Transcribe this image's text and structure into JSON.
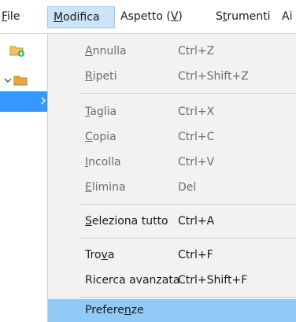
{
  "menubar": {
    "file": {
      "mnemonic": "F",
      "rest": "ile"
    },
    "modifica": {
      "mnemonic": "M",
      "rest": "odifica"
    },
    "aspetto": {
      "pre": "Aspetto (",
      "mnemonic": "V",
      "post": ")"
    },
    "strumenti": {
      "pre": "S",
      "mnemonic": "t",
      "post": "rumenti"
    },
    "truncated": "Ai"
  },
  "menu": {
    "items": [
      {
        "pre": "",
        "mnemonic": "A",
        "post": "nnulla",
        "shortcut": "Ctrl+Z",
        "enabled": false
      },
      {
        "pre": "",
        "mnemonic": "R",
        "post": "ipeti",
        "shortcut": "Ctrl+Shift+Z",
        "enabled": false
      },
      {
        "pre": "",
        "mnemonic": "T",
        "post": "aglia",
        "shortcut": "Ctrl+X",
        "enabled": false
      },
      {
        "pre": "",
        "mnemonic": "C",
        "post": "opia",
        "shortcut": "Ctrl+C",
        "enabled": false
      },
      {
        "pre": "",
        "mnemonic": "I",
        "post": "ncolla",
        "shortcut": "Ctrl+V",
        "enabled": false
      },
      {
        "pre": "",
        "mnemonic": "E",
        "post": "limina",
        "shortcut": "Del",
        "enabled": false
      },
      {
        "pre": "",
        "mnemonic": "S",
        "post": "eleziona tutto",
        "shortcut": "Ctrl+A",
        "enabled": true
      },
      {
        "pre": "Tro",
        "mnemonic": "v",
        "post": "a",
        "shortcut": "Ctrl+F",
        "enabled": true
      },
      {
        "pre": "Ricerca avanzata",
        "mnemonic": "",
        "post": "",
        "shortcut": "Ctrl+Shift+F",
        "enabled": true
      },
      {
        "pre": "Prefere",
        "mnemonic": "n",
        "post": "ze",
        "shortcut": "",
        "enabled": true,
        "highlighted": true
      }
    ]
  },
  "colors": {
    "selection": "#3399ff",
    "hover": "#91c9f7",
    "active_menu": "#cce4f7",
    "disabled_text": "#6d6d6d"
  },
  "icons": [
    "new-folder-icon",
    "chevron-down-icon",
    "folder-icon",
    "chevron-right-icon"
  ]
}
